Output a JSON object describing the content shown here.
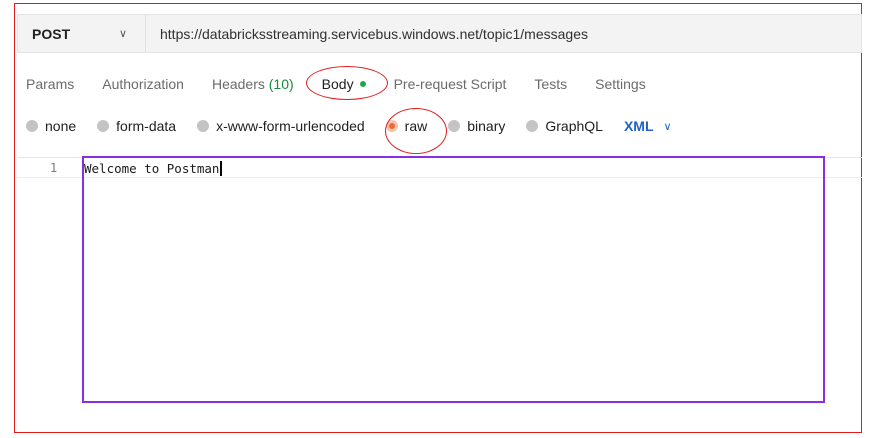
{
  "request": {
    "method": "POST",
    "url": "https://databricksstreaming.servicebus.windows.net/topic1/messages"
  },
  "tabs": [
    {
      "label": "Params"
    },
    {
      "label": "Authorization"
    },
    {
      "label": "Headers",
      "count": "(10)"
    },
    {
      "label": "Body",
      "active": true
    },
    {
      "label": "Pre-request Script"
    },
    {
      "label": "Tests"
    },
    {
      "label": "Settings"
    }
  ],
  "body_modes": [
    {
      "label": "none"
    },
    {
      "label": "form-data"
    },
    {
      "label": "x-www-form-urlencoded"
    },
    {
      "label": "raw",
      "selected": true
    },
    {
      "label": "binary"
    },
    {
      "label": "GraphQL"
    }
  ],
  "raw_format": "XML",
  "editor": {
    "line_number": "1",
    "content": "Welcome to Postman"
  },
  "colors": {
    "annotation_red": "#e41b1b",
    "annotation_purple": "#8b2ee0",
    "format_blue": "#1e63c5",
    "active_dot_green": "#1fa84a",
    "selected_radio_orange": "#ef6c2f"
  }
}
